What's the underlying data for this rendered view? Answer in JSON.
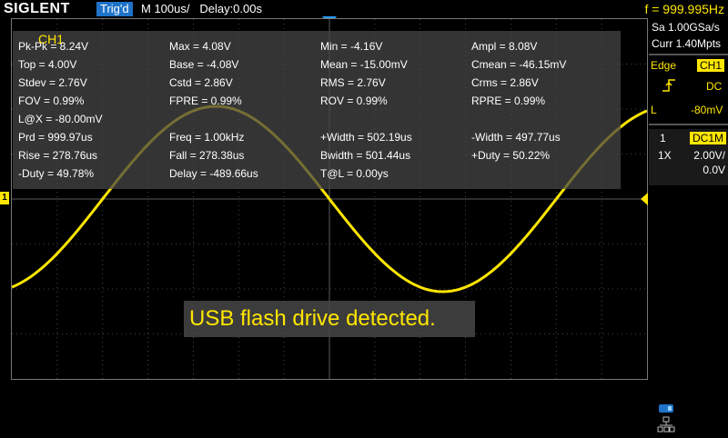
{
  "brand": "SIGLENT",
  "status": {
    "trig": "Trig'd",
    "timebase": "M 100us/",
    "delay": "Delay:0.00s"
  },
  "freq_readout": "f = 999.995Hz",
  "acquisition": {
    "sample_rate": "Sa 1.00GSa/s",
    "memory": "Curr 1.40Mpts"
  },
  "trigger": {
    "type": "Edge",
    "source": "CH1",
    "coupling": "DC",
    "level_label": "L",
    "level": "-80mV"
  },
  "channel": {
    "number": "1",
    "coupling": "DC1M",
    "probe": "1X",
    "scale": "2.00V/",
    "offset": "0.0V"
  },
  "channel_marker": "1",
  "measurements": {
    "title": "CH1",
    "items": [
      "Pk-Pk = 8.24V",
      "Max = 4.08V",
      "Min = -4.16V",
      "Ampl = 8.08V",
      "Top = 4.00V",
      "Base = -4.08V",
      "Mean = -15.00mV",
      "Cmean = -46.15mV",
      "Stdev = 2.76V",
      "Cstd = 2.86V",
      "RMS = 2.76V",
      "Crms = 2.86V",
      "FOV = 0.99%",
      "FPRE = 0.99%",
      "ROV = 0.99%",
      "RPRE = 0.99%",
      "L@X = -80.00mV",
      "Prd = 999.97us",
      "Freq = 1.00kHz",
      "+Width = 502.19us",
      "-Width = 497.77us",
      "Rise = 278.76us",
      "Fall = 278.38us",
      "Bwidth = 501.44us",
      "+Duty = 50.22%",
      "-Duty = 49.78%",
      "Delay = -489.66us",
      "T@L = 0.00ys"
    ]
  },
  "message": "USB flash drive detected.",
  "colors": {
    "ch1": "#ffe600",
    "accent": "#1e73c8",
    "grid": "#5a5a5a"
  },
  "waveform": {
    "type": "sine",
    "frequency_hz": 1000,
    "amplitude_v": 4.12,
    "volts_per_div": 2,
    "time_per_div_s": 0.0001,
    "phase_deg": 180
  }
}
